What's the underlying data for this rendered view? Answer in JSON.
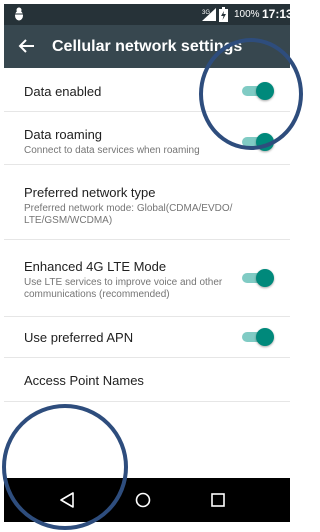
{
  "status_bar": {
    "network": "3G",
    "battery": "100%",
    "time": "17:13",
    "icons": [
      "debug-bug-icon",
      "signal-3g-icon",
      "battery-charging-icon"
    ]
  },
  "app_bar": {
    "title": "Cellular network settings",
    "back_icon": "arrow-back-icon"
  },
  "settings": [
    {
      "title": "Data enabled",
      "toggle": true
    },
    {
      "title": "Data roaming",
      "summary": "Connect to data services when roaming",
      "toggle": true
    },
    {
      "title": "Preferred network type",
      "summary": "Preferred network mode: Global(CDMA/EVDO/ LTE/GSM/WCDMA)"
    },
    {
      "title": "Enhanced 4G LTE Mode",
      "summary": "Use LTE services to improve voice and other communications (recommended)",
      "toggle": true
    },
    {
      "title": "Use preferred APN",
      "toggle": true
    },
    {
      "title": "Access Point Names"
    }
  ],
  "nav_bar": {
    "buttons": [
      "back-triangle-icon",
      "home-circle-icon",
      "recents-square-icon"
    ]
  },
  "colors": {
    "status_bar": "#263238",
    "app_bar": "#37474f",
    "toggle_thumb": "#00897b",
    "toggle_track": "#80cbc4",
    "annotation_circle": "#2e4d7d"
  }
}
